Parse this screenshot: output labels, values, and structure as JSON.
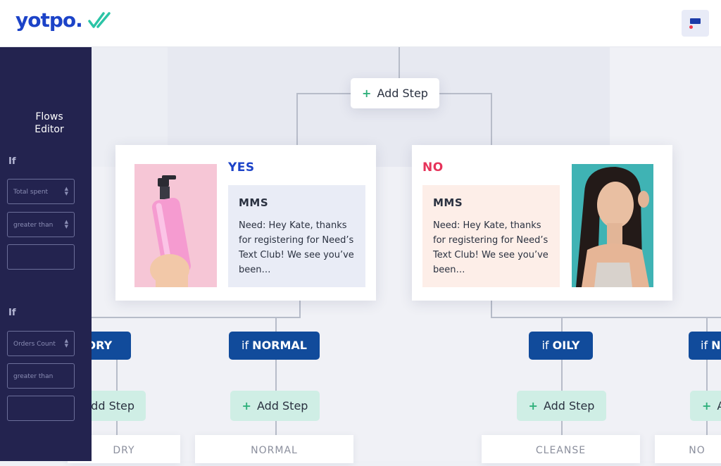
{
  "header": {
    "logo": "yotpo."
  },
  "sidebar": {
    "title_line1": "Flows",
    "title_line2": "Editor",
    "group1": {
      "if_label": "If",
      "field1": "Total spent",
      "field2": "greater than",
      "field3": ""
    },
    "group2": {
      "if_label": "If",
      "field1": "Orders Count",
      "field2": "greater than",
      "field3": ""
    }
  },
  "top_step": {
    "label": "Add Step"
  },
  "branches": {
    "yes": {
      "label": "YES",
      "msg_title": "MMS",
      "msg_body": "Need: Hey Kate, thanks for registering for Need’s Text Club! We see you’ve been…"
    },
    "no": {
      "label": "NO",
      "msg_title": "MMS",
      "msg_body": "Need: Hey Kate, thanks for registering for Need’s Text Club! We see you’ve been…"
    }
  },
  "conditions": [
    {
      "prefix": "",
      "value": "DRY"
    },
    {
      "prefix": "if ",
      "value": "NORMAL"
    },
    {
      "prefix": "if ",
      "value": "OILY"
    },
    {
      "prefix": "if ",
      "value": "N"
    }
  ],
  "steps": [
    {
      "label": "dd Step"
    },
    {
      "label": "Add Step"
    },
    {
      "label": "Add Step"
    },
    {
      "label": "A"
    }
  ],
  "bottom_cards": [
    "DRY",
    "NORMAL",
    "CLEANSE",
    "NO"
  ],
  "colors": {
    "brand": "#1c43c8",
    "accent_green": "#2fb07b",
    "yes": "#1c43c8",
    "no": "#e6335a",
    "condition_bg": "#114b9b",
    "sidebar_bg": "#23234f"
  }
}
